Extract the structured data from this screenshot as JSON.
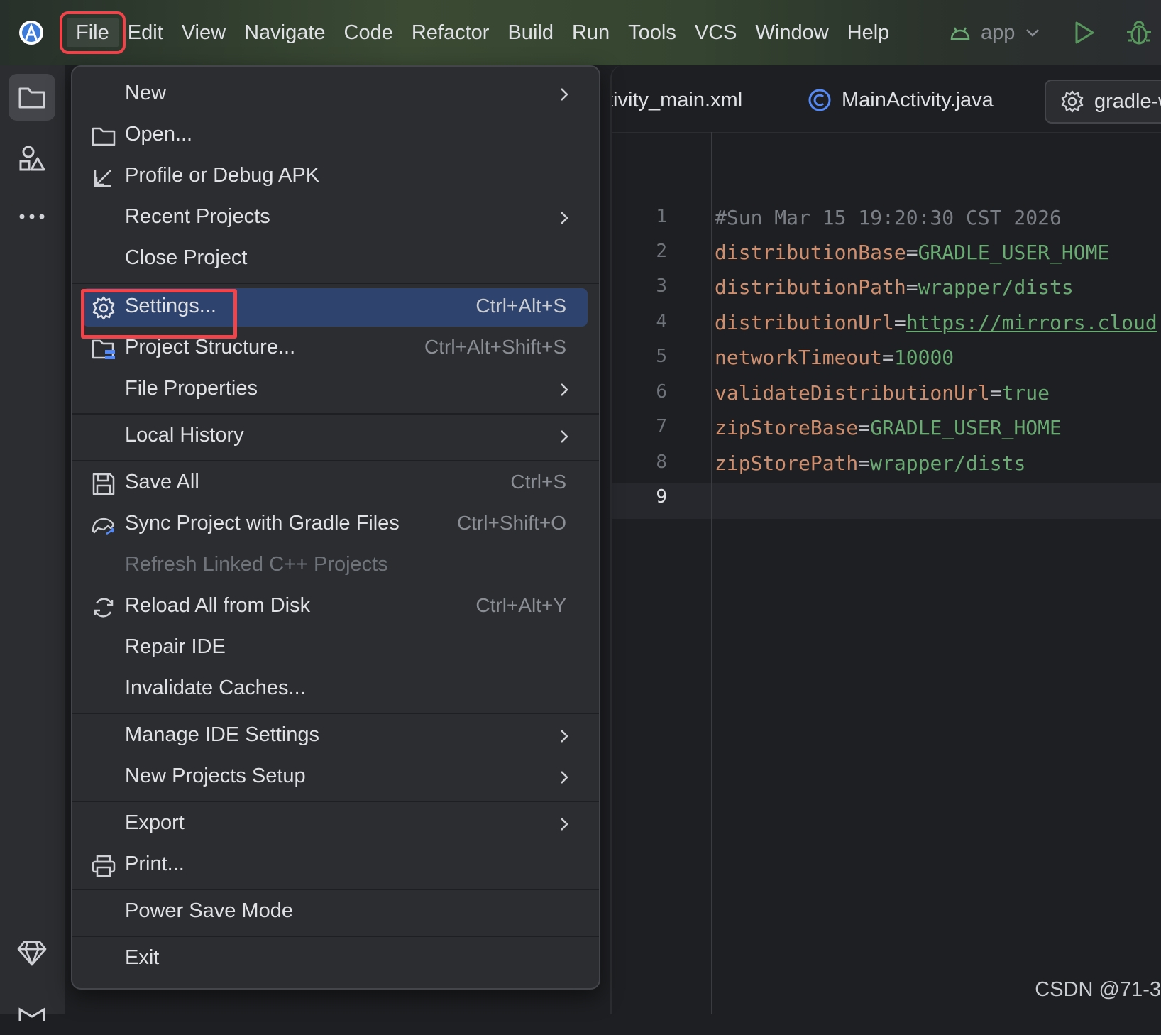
{
  "menubar": {
    "items": [
      "File",
      "Edit",
      "View",
      "Navigate",
      "Code",
      "Refactor",
      "Build",
      "Run",
      "Tools",
      "VCS",
      "Window",
      "Help"
    ],
    "active": "File"
  },
  "run_config": {
    "name": "app"
  },
  "editor": {
    "tabs": [
      "tivity_main.xml",
      "MainActivity.java",
      "gradle-w"
    ],
    "lines": [
      {
        "n": "1",
        "comment": "#Sun Mar 15 19:20:30 CST 2026"
      },
      {
        "n": "2",
        "key": "distributionBase",
        "eq": "=",
        "val": "GRADLE_USER_HOME"
      },
      {
        "n": "3",
        "key": "distributionPath",
        "eq": "=",
        "val": "wrapper/dists"
      },
      {
        "n": "4",
        "key": "distributionUrl",
        "eq": "=",
        "url": "https://mirrors.cloud"
      },
      {
        "n": "5",
        "key": "networkTimeout",
        "eq": "=",
        "val": "10000"
      },
      {
        "n": "6",
        "key": "validateDistributionUrl",
        "eq": "=",
        "val": "true"
      },
      {
        "n": "7",
        "key": "zipStoreBase",
        "eq": "=",
        "val": "GRADLE_USER_HOME"
      },
      {
        "n": "8",
        "key": "zipStorePath",
        "eq": "=",
        "val": "wrapper/dists"
      },
      {
        "n": "9"
      }
    ]
  },
  "file_menu": {
    "items": [
      {
        "label": "New",
        "submenu": true
      },
      {
        "label": "Open...",
        "icon": "folder-icon"
      },
      {
        "label": "Profile or Debug APK",
        "icon": "profile-apk-icon"
      },
      {
        "label": "Recent Projects",
        "submenu": true
      },
      {
        "label": "Close Project"
      },
      {
        "label": "Settings...",
        "shortcut": "Ctrl+Alt+S",
        "icon": "gear-icon",
        "selected": true
      },
      {
        "label": "Project Structure...",
        "shortcut": "Ctrl+Alt+Shift+S",
        "icon": "project-structure-icon"
      },
      {
        "label": "File Properties",
        "submenu": true
      },
      {
        "label": "Local History",
        "submenu": true
      },
      {
        "label": "Save All",
        "shortcut": "Ctrl+S",
        "icon": "save-icon"
      },
      {
        "label": "Sync Project with Gradle Files",
        "shortcut": "Ctrl+Shift+O",
        "icon": "gradle-sync-icon"
      },
      {
        "label": "Refresh Linked C++ Projects",
        "disabled": true
      },
      {
        "label": "Reload All from Disk",
        "shortcut": "Ctrl+Alt+Y",
        "icon": "reload-icon"
      },
      {
        "label": "Repair IDE"
      },
      {
        "label": "Invalidate Caches..."
      },
      {
        "label": "Manage IDE Settings",
        "submenu": true
      },
      {
        "label": "New Projects Setup",
        "submenu": true
      },
      {
        "label": "Export",
        "submenu": true
      },
      {
        "label": "Print...",
        "icon": "printer-icon"
      },
      {
        "label": "Power Save Mode"
      },
      {
        "label": "Exit"
      }
    ]
  },
  "watermark": "CSDN @71-3",
  "colors": {
    "highlight": "#f0434a",
    "selection": "#2e436e",
    "menu_bg": "#2b2d30",
    "editor_bg": "#1e1f22"
  }
}
